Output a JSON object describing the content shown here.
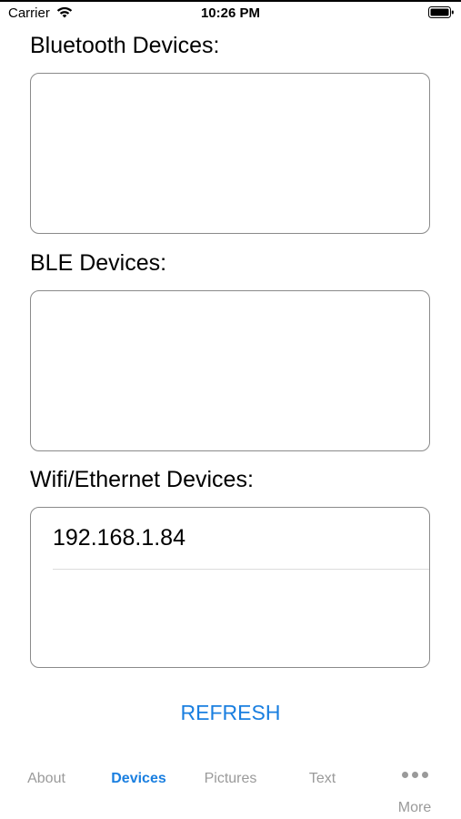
{
  "status_bar": {
    "carrier": "Carrier",
    "time": "10:26 PM",
    "icons": [
      "wifi-icon",
      "battery-icon"
    ]
  },
  "sections": {
    "bluetooth": {
      "title": "Bluetooth Devices:",
      "items": []
    },
    "ble": {
      "title": "BLE Devices:",
      "items": []
    },
    "wifi": {
      "title": "Wifi/Ethernet Devices:",
      "items": [
        "192.168.1.84"
      ]
    }
  },
  "refresh_label": "REFRESH",
  "tab_bar": {
    "tabs": [
      {
        "label": "About",
        "active": false
      },
      {
        "label": "Devices",
        "active": true
      },
      {
        "label": "Pictures",
        "active": false
      },
      {
        "label": "Text",
        "active": false
      },
      {
        "label": "More",
        "active": false,
        "icon": "more-icon"
      }
    ]
  },
  "colors": {
    "accent": "#1a7fe0",
    "inactive_tab": "#9a9a9a",
    "box_border": "#8a8a8a"
  }
}
